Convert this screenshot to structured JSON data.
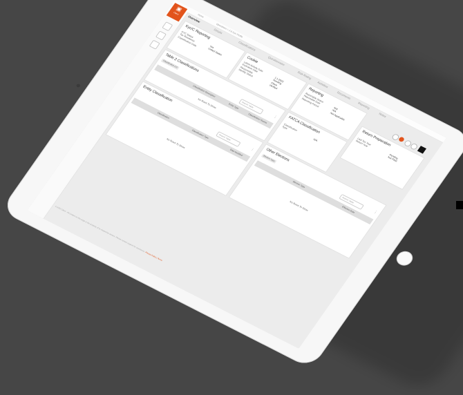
{
  "app": {
    "logo_label": "Client",
    "breadcrumb_a": "Home",
    "breadcrumb_b": "Operations > 2 & Kyc Profile"
  },
  "tabs": [
    {
      "label": "Overview",
      "active": true
    },
    {
      "label": "Details"
    },
    {
      "label": "Classifications"
    },
    {
      "label": "Questionnaire"
    },
    {
      "label": "Risk Rating"
    },
    {
      "label": "Activities"
    },
    {
      "label": "Documents"
    },
    {
      "label": "Reporting"
    },
    {
      "label": "Notes"
    }
  ],
  "cards": {
    "kyc": {
      "title": "Kyc/C Reporting",
      "rows": [
        [
          "KYC Status",
          "Yes"
        ],
        [
          "Tax Residence",
          "United States"
        ],
        [
          "Classification Date",
          ""
        ]
      ]
    },
    "cookie": {
      "title": "Cookie",
      "rows": [
        [
          "Latest Activity Date",
          "1.1.2022"
        ],
        [
          "Expiration Date",
          "Pending"
        ],
        [
          "Responsible",
          "Client"
        ],
        [
          "Identity Status",
          "Verified"
        ]
      ]
    },
    "reporting": {
      "title": "Reporting",
      "rows": [
        [
          "Reportable Status",
          "N/A"
        ],
        [
          "Reportable Date",
          "N/A"
        ],
        [
          "Reporting Period",
          "Not Applicable"
        ]
      ]
    },
    "return_preparation": {
      "title": "Return Preparation",
      "rows": [
        [
          "Last Tax Year",
          "Pending"
        ],
        [
          "Return Year",
          "Not Filed"
        ]
      ]
    },
    "table2": {
      "title": "Table 2 Classifications",
      "pill_a": "Classification 2.0",
      "search_placeholder": "Search Table",
      "col_a": "Classification Description",
      "col_b": "Entity Type",
      "col_c": "Classification Source",
      "empty": "No Rows To Show"
    },
    "fatca": {
      "title": "FATCA Classification",
      "rows": [
        [
          "Classification",
          "N/A"
        ],
        [
          "Type",
          ""
        ]
      ]
    },
    "entity": {
      "title": "Entity Classification",
      "search_placeholder": "Search Table",
      "col_a": "Classification",
      "col_b": "Classification Type",
      "col_c": "Date Modified",
      "empty": "No Rows To Show"
    },
    "other": {
      "title": "Other Elections",
      "pill_a": "Election Type",
      "search_placeholder": "Search Table",
      "col_a": "Election Type",
      "col_b": "Effective Date",
      "empty": "No Rows To Show"
    }
  },
  "footer": {
    "text": "© 2022 Client - All content on this page is the property of its respective owners. Please contact support for assistance.",
    "links": "Privacy Policy | Terms"
  },
  "colors": {
    "accent": "#e2541c",
    "background": "#464646"
  }
}
